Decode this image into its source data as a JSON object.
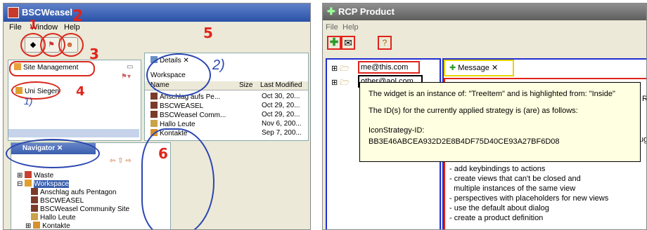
{
  "left": {
    "app_title": "BSCWeasel",
    "menu": [
      "File",
      "Window",
      "Help"
    ],
    "site_management_tab": "Site Management",
    "site_item": "Uni Siegen",
    "details_tab": "Details",
    "details_header": "Workspace",
    "columns": [
      "Name",
      "Size",
      "Last Modified"
    ],
    "rows": [
      {
        "name": "Anschlag aufs Pe...",
        "modified": "Oct 30, 20..."
      },
      {
        "name": "BSCWEASEL",
        "modified": "Oct 29, 20..."
      },
      {
        "name": "BSCWeasel Comm...",
        "modified": "Oct 29, 20..."
      },
      {
        "name": "Hallo Leute",
        "modified": "Nov 6, 200..."
      },
      {
        "name": "Kontakte",
        "modified": "Sep 7, 200..."
      }
    ],
    "navigator_tab": "Navigator",
    "navigator_items": [
      "Waste",
      "Workspace",
      "Anschlag aufs Pentagon",
      "BSCWEASEL",
      "BSCWeasel Community Site",
      "Hallo Leute",
      "Kontakte"
    ],
    "annotations": [
      "1",
      "2",
      "3",
      "4",
      "5",
      "6",
      "2)",
      "1)"
    ]
  },
  "right": {
    "app_title": "RCP Product",
    "menu": [
      "File",
      "Help"
    ],
    "tree": [
      "me@this.com",
      "other@aol.com"
    ],
    "message_tab": "Message",
    "subject_fragment": "ug",
    "fragment_rc": "RC",
    "tooltip": {
      "line1": "The widget is an instance of: \"TreeItem\" and is highlighted from: \"Inside\"",
      "line2": "The ID(s) for the currently applied strategy is (are) as follows:",
      "line3": "IconStrategy-ID:",
      "line4": "BB3E46ABCEA932D2E8B4DF75D40CE93A27BF6D08"
    },
    "body_lines": [
      "- add keybindings to actions",
      "- create views that can't be closed and",
      "  multiple instances of the same view",
      "- perspectives with placeholders for new views",
      "- use the default about dialog",
      "- create a product definition"
    ]
  },
  "colors": {
    "highlight_red": "#e0241b",
    "highlight_blue": "#1f2fd0",
    "highlight_yellow": "#e8d400",
    "pen_blue": "#2a46b0"
  }
}
